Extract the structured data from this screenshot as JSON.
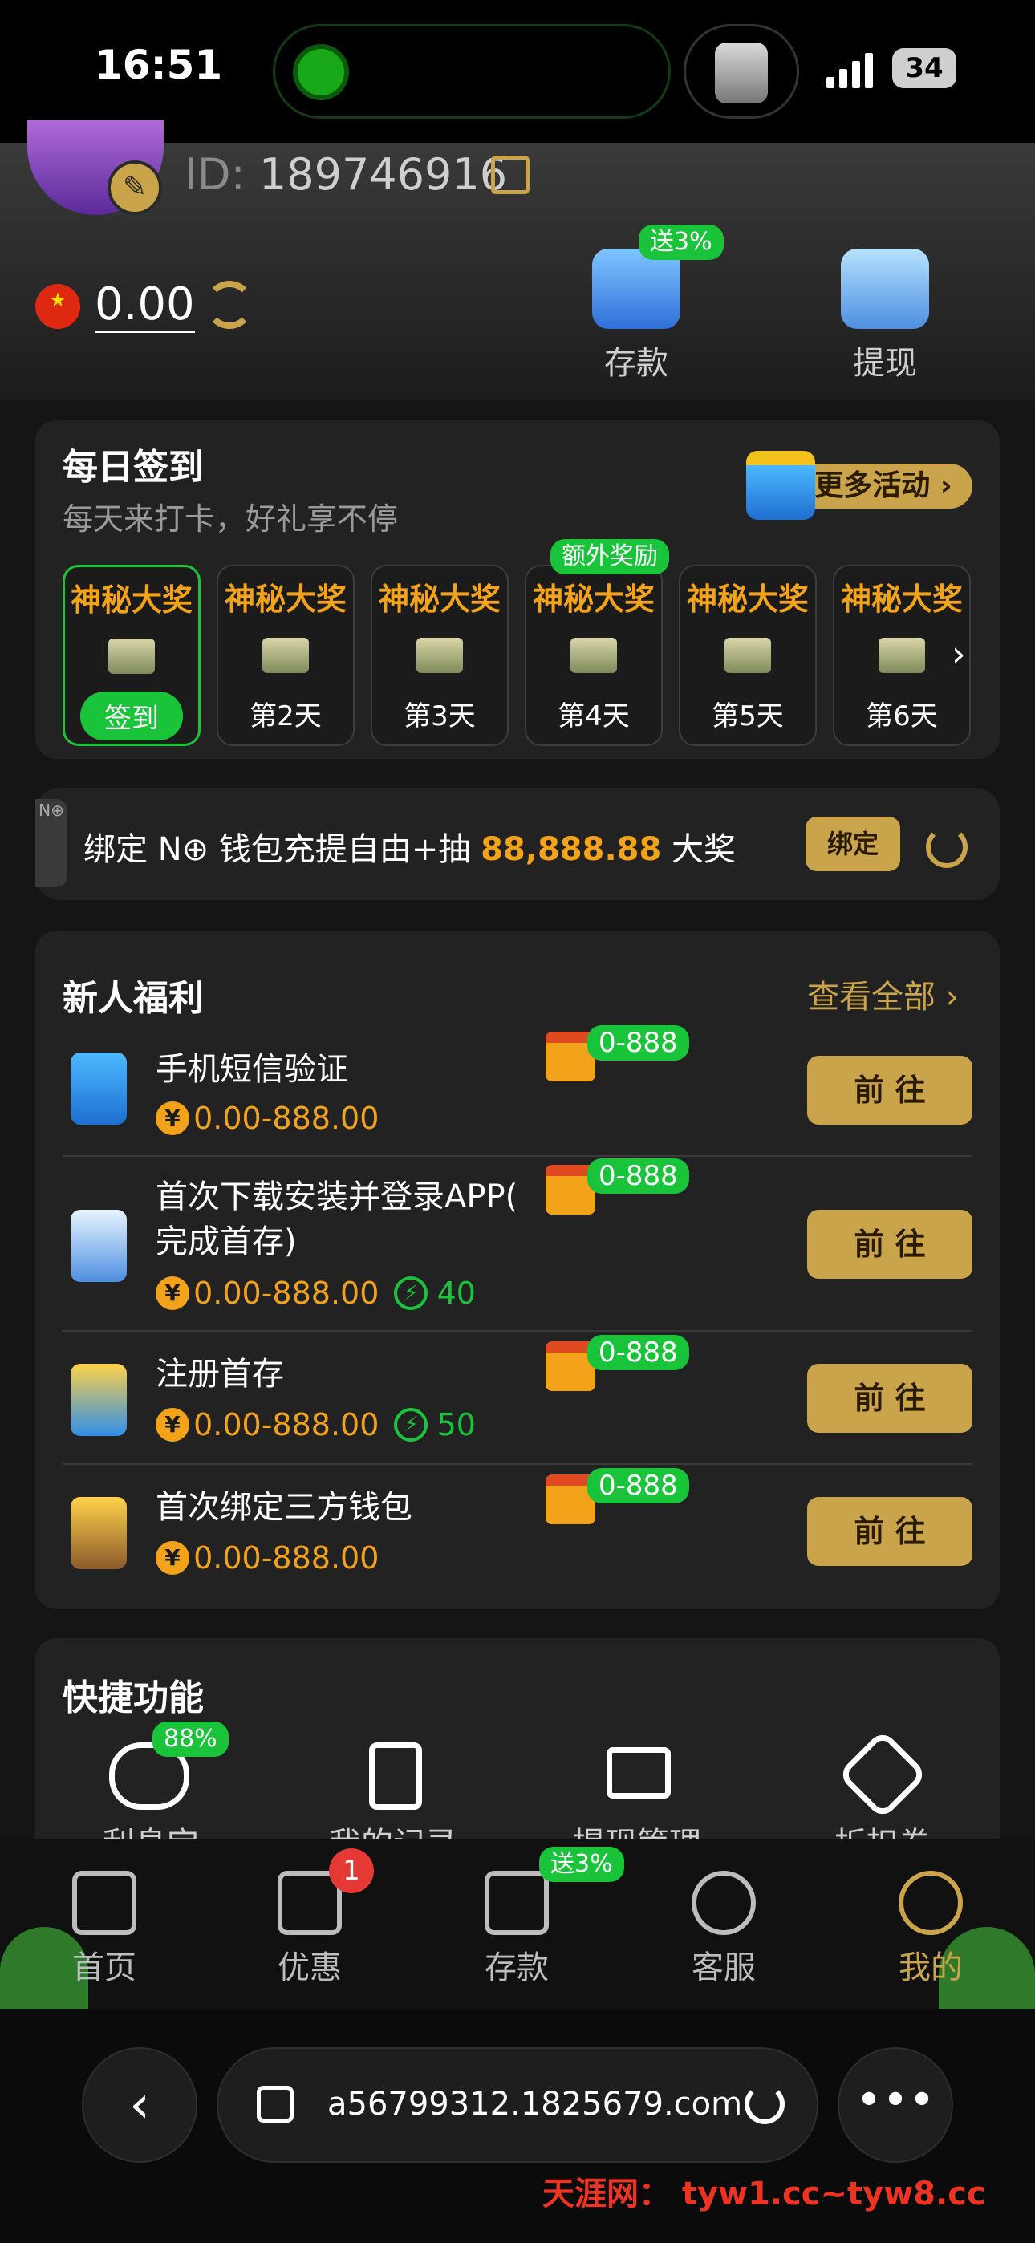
{
  "status_bar": {
    "time": "16:51",
    "battery": "34"
  },
  "profile": {
    "id_label": "ID:",
    "id_value": "189746916",
    "balance": "0.00"
  },
  "header_actions": {
    "deposit": "存款",
    "deposit_badge": "送3%",
    "withdraw": "提现"
  },
  "checkin": {
    "title": "每日签到",
    "subtitle": "每天来打卡，好礼享不停",
    "more_label": "更多活动",
    "extra_badge": "额外奖励",
    "days": [
      {
        "head": "神秘大奖",
        "label": "签到"
      },
      {
        "head": "神秘大奖",
        "label": "第2天"
      },
      {
        "head": "神秘大奖",
        "label": "第3天"
      },
      {
        "head": "神秘大奖",
        "label": "第4天"
      },
      {
        "head": "神秘大奖",
        "label": "第5天"
      },
      {
        "head": "神秘大奖",
        "label": "第6天"
      }
    ]
  },
  "wallet_banner": {
    "text_a": "绑定 N⊕ 钱包充提自由+抽 ",
    "amount": "88,888.88",
    "text_b": " 大奖",
    "bind": "绑定",
    "side": "N⊕"
  },
  "newbie": {
    "title": "新人福利",
    "view_all": "查看全部",
    "go_label": "前 往",
    "reward_badge": "0-888",
    "items": [
      {
        "title": "手机短信验证",
        "amount": "0.00-888.00",
        "bolt": ""
      },
      {
        "title": "首次下载安装并登录APP(",
        "title2": "完成首存)",
        "amount": "0.00-888.00",
        "bolt": "40"
      },
      {
        "title": "注册首存",
        "amount": "0.00-888.00",
        "bolt": "50"
      },
      {
        "title": "首次绑定三方钱包",
        "amount": "0.00-888.00",
        "bolt": ""
      }
    ]
  },
  "quick": {
    "title": "快捷功能",
    "badge": "88%",
    "items": [
      "利息宝",
      "我的记录",
      "提现管理",
      "折扣券"
    ]
  },
  "bottom_nav": {
    "items": [
      "首页",
      "优惠",
      "存款",
      "客服",
      "我的"
    ],
    "promo_count": "1",
    "deposit_badge": "送3%"
  },
  "browser": {
    "url": "a56799312.1825679.com"
  },
  "watermark": "天涯网：  tyw1.cc~tyw8.cc",
  "colors": {
    "gold": "#c9a44a",
    "green": "#19c43a",
    "orange": "#f3a31a",
    "bg": "#151515"
  }
}
